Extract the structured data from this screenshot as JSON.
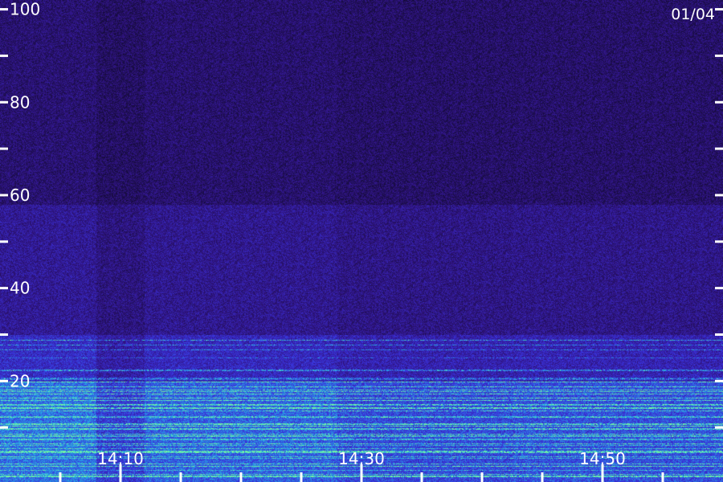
{
  "chart_data": {
    "type": "heatmap",
    "title": "",
    "xlabel": "",
    "ylabel": "",
    "date_label": "01/04",
    "ylim": [
      0,
      102
    ],
    "y_ticks": [
      {
        "value": 100,
        "label": "100"
      },
      {
        "value": 80,
        "label": "80"
      },
      {
        "value": 60,
        "label": "60"
      },
      {
        "value": 40,
        "label": "40"
      },
      {
        "value": 20,
        "label": "20"
      }
    ],
    "y_minor_ticks": [
      90,
      70,
      50,
      30,
      10
    ],
    "x_ticks": [
      {
        "label": "14:10"
      },
      {
        "label": "14:30"
      },
      {
        "label": "14:50"
      }
    ],
    "colormap": [
      "#1a0f3d",
      "#2a1a78",
      "#3a2ac0",
      "#2f6fe0",
      "#28c8e8",
      "#6ff0a0"
    ],
    "bands": [
      {
        "y_from": 0,
        "y_to": 20,
        "level": "high"
      },
      {
        "y_from": 20,
        "y_to": 30,
        "level": "medium"
      },
      {
        "y_from": 30,
        "y_to": 58,
        "level": "low"
      },
      {
        "y_from": 58,
        "y_to": 102,
        "level": "background"
      }
    ]
  }
}
